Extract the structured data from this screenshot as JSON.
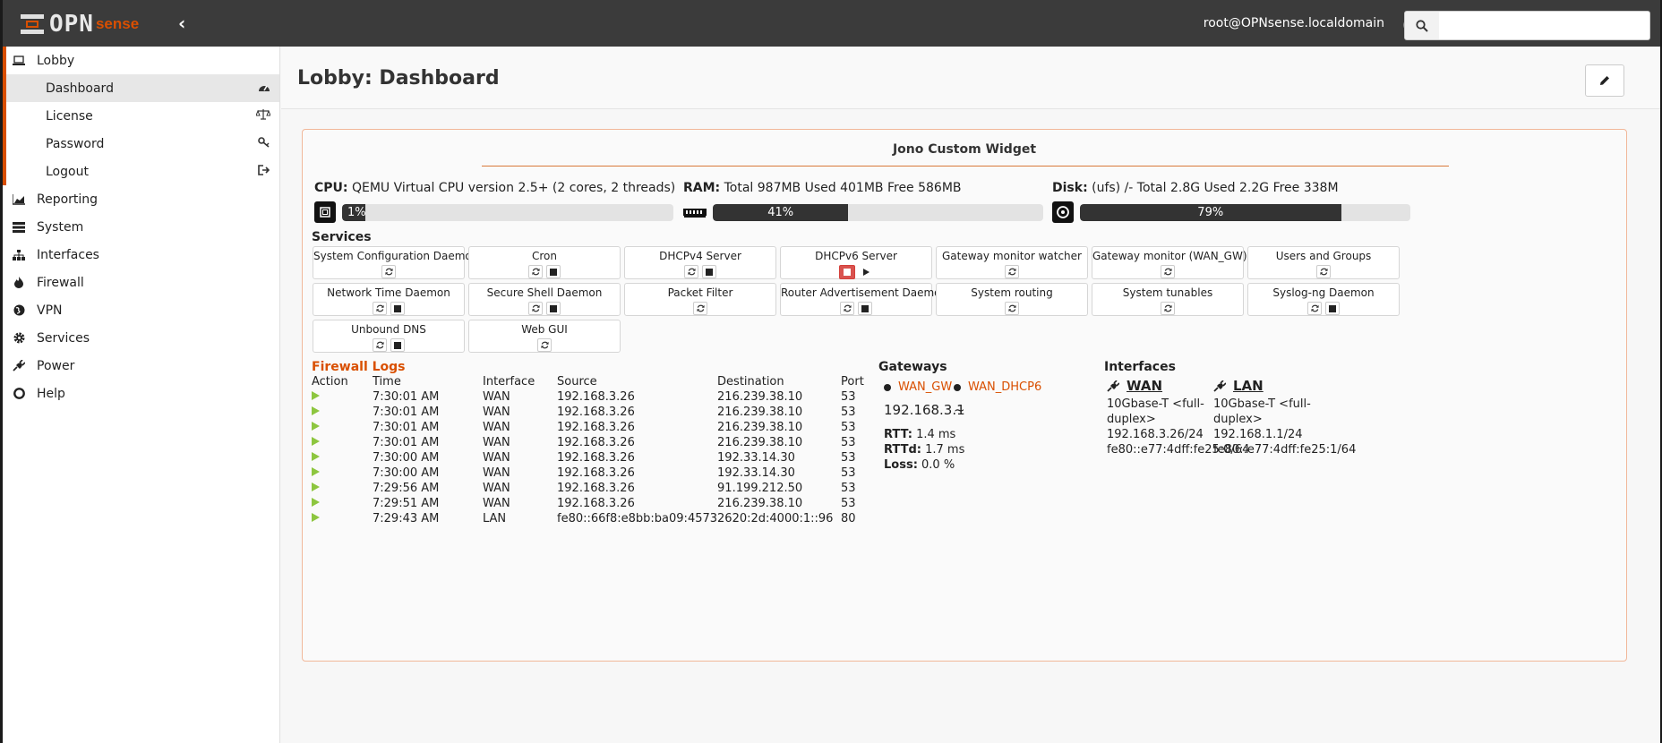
{
  "topbar": {
    "logo_opn": "OPN",
    "logo_sense": "sense",
    "collapse_glyph": "‹",
    "user": "root@OPNsense.localdomain",
    "search": {
      "value": "",
      "placeholder": ""
    }
  },
  "sidebar": {
    "lobby": {
      "label": "Lobby",
      "icon": "laptop-icon"
    },
    "sub_items": [
      {
        "label": "Dashboard",
        "icon": "dashboard-icon",
        "active": true
      },
      {
        "label": "License",
        "icon": "balance-icon"
      },
      {
        "label": "Password",
        "icon": "key-icon"
      },
      {
        "label": "Logout",
        "icon": "sign-out-icon"
      }
    ],
    "items": [
      {
        "label": "Reporting",
        "icon": "chart-icon"
      },
      {
        "label": "System",
        "icon": "server-icon"
      },
      {
        "label": "Interfaces",
        "icon": "sitemap-icon"
      },
      {
        "label": "Firewall",
        "icon": "fire-icon"
      },
      {
        "label": "VPN",
        "icon": "globe-icon"
      },
      {
        "label": "Services",
        "icon": "cog-icon"
      },
      {
        "label": "Power",
        "icon": "plug-icon"
      },
      {
        "label": "Help",
        "icon": "life-ring-icon"
      }
    ]
  },
  "page": {
    "title": "Lobby: Dashboard"
  },
  "widget": {
    "title": "Jono Custom Widget",
    "cpu": {
      "label": "CPU:",
      "text": " QEMU Virtual CPU version 2.5+ (2 cores, 2 threads)",
      "percent": 1,
      "percent_label": "1%"
    },
    "ram": {
      "label": "RAM:",
      "text": " Total 987MB Used 401MB Free 586MB",
      "percent": 41,
      "percent_label": "41%"
    },
    "disk": {
      "label": "Disk:",
      "text": " (ufs) /- Total 2.8G Used 2.2G Free 338M",
      "percent": 79,
      "percent_label": "79%"
    },
    "services_title": "Services",
    "services": [
      {
        "name": "System Configuration Daemon",
        "buttons": [
          "restart"
        ]
      },
      {
        "name": "Cron",
        "buttons": [
          "restart",
          "stop"
        ]
      },
      {
        "name": "DHCPv4 Server",
        "buttons": [
          "restart",
          "stop"
        ]
      },
      {
        "name": "DHCPv6 Server",
        "buttons": [
          "stopped",
          "start"
        ]
      },
      {
        "name": "Gateway monitor watcher",
        "buttons": [
          "restart"
        ]
      },
      {
        "name": "Gateway monitor (WAN_GW)",
        "buttons": [
          "restart"
        ]
      },
      {
        "name": "Users and Groups",
        "buttons": [
          "restart"
        ]
      },
      {
        "name": "Network Time Daemon",
        "buttons": [
          "restart",
          "stop"
        ]
      },
      {
        "name": "Secure Shell Daemon",
        "buttons": [
          "restart",
          "stop"
        ]
      },
      {
        "name": "Packet Filter",
        "buttons": [
          "restart"
        ]
      },
      {
        "name": "Router Advertisement Daemon",
        "buttons": [
          "restart",
          "stop"
        ]
      },
      {
        "name": "System routing",
        "buttons": [
          "restart"
        ]
      },
      {
        "name": "System tunables",
        "buttons": [
          "restart"
        ]
      },
      {
        "name": "Syslog-ng Daemon",
        "buttons": [
          "restart",
          "stop"
        ]
      },
      {
        "name": "Unbound DNS",
        "buttons": [
          "restart",
          "stop"
        ]
      },
      {
        "name": "Web GUI",
        "buttons": [
          "restart"
        ]
      }
    ],
    "firewall_logs": {
      "title": "Firewall Logs",
      "columns": [
        "Action",
        "Time",
        "Interface",
        "Source",
        "Destination",
        "Port"
      ],
      "rows": [
        {
          "action": "pass",
          "time": "7:30:01 AM",
          "interface": "WAN",
          "source": "192.168.3.26",
          "destination": "216.239.38.10",
          "port": "53"
        },
        {
          "action": "pass",
          "time": "7:30:01 AM",
          "interface": "WAN",
          "source": "192.168.3.26",
          "destination": "216.239.38.10",
          "port": "53"
        },
        {
          "action": "pass",
          "time": "7:30:01 AM",
          "interface": "WAN",
          "source": "192.168.3.26",
          "destination": "216.239.38.10",
          "port": "53"
        },
        {
          "action": "pass",
          "time": "7:30:01 AM",
          "interface": "WAN",
          "source": "192.168.3.26",
          "destination": "216.239.38.10",
          "port": "53"
        },
        {
          "action": "pass",
          "time": "7:30:00 AM",
          "interface": "WAN",
          "source": "192.168.3.26",
          "destination": "192.33.14.30",
          "port": "53"
        },
        {
          "action": "pass",
          "time": "7:30:00 AM",
          "interface": "WAN",
          "source": "192.168.3.26",
          "destination": "192.33.14.30",
          "port": "53"
        },
        {
          "action": "pass",
          "time": "7:29:56 AM",
          "interface": "WAN",
          "source": "192.168.3.26",
          "destination": "91.199.212.50",
          "port": "53"
        },
        {
          "action": "pass",
          "time": "7:29:51 AM",
          "interface": "WAN",
          "source": "192.168.3.26",
          "destination": "216.239.38.10",
          "port": "53"
        },
        {
          "action": "pass",
          "time": "7:29:43 AM",
          "interface": "LAN",
          "source": "fe80::66f8:e8bb:ba09:4573",
          "destination": "2620:2d:4000:1::96",
          "port": "80"
        }
      ]
    },
    "gateways": {
      "title": "Gateways",
      "items": [
        {
          "name": "WAN_GW",
          "address": "192.168.3.1",
          "rtt_label": "RTT:",
          "rtt": " 1.4 ms",
          "rttd_label": "RTTd:",
          "rttd": " 1.7 ms",
          "loss_label": "Loss:",
          "loss": " 0.0 %"
        },
        {
          "name": "WAN_DHCP6",
          "address": "~"
        }
      ]
    },
    "interfaces": {
      "title": "Interfaces",
      "items": [
        {
          "name": "WAN",
          "media": "10Gbase-T <full-duplex>",
          "ipv4": "192.168.3.26/24",
          "ipv6": "fe80::e77:4dff:fe25:0/64"
        },
        {
          "name": "LAN",
          "media": "10Gbase-T <full-duplex>",
          "ipv4": "192.168.1.1/24",
          "ipv6": "fe80::e77:4dff:fe25:1/64"
        }
      ]
    }
  }
}
